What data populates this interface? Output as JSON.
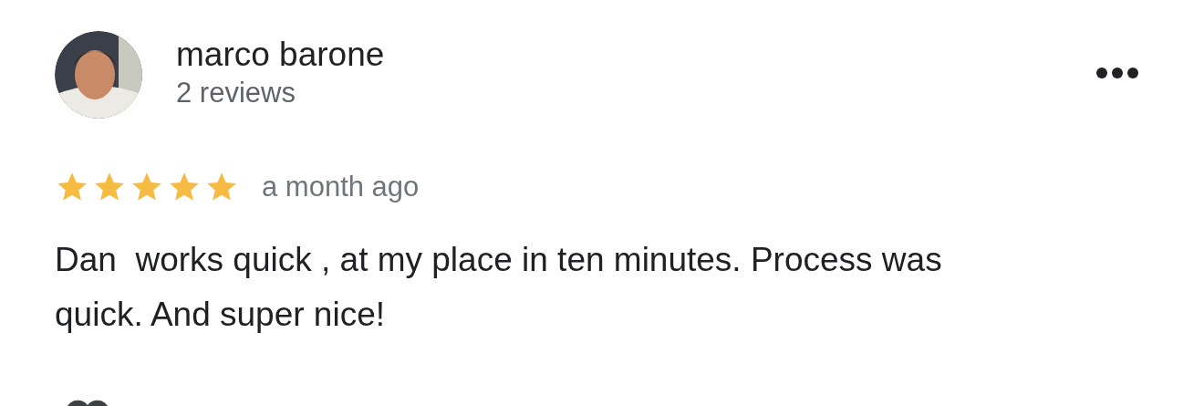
{
  "review": {
    "author": "marco barone",
    "author_meta": "2 reviews",
    "stars": 5,
    "time": "a month ago",
    "text": "Dan  works quick , at my place in ten minutes. Process was quick. And super nice!"
  }
}
